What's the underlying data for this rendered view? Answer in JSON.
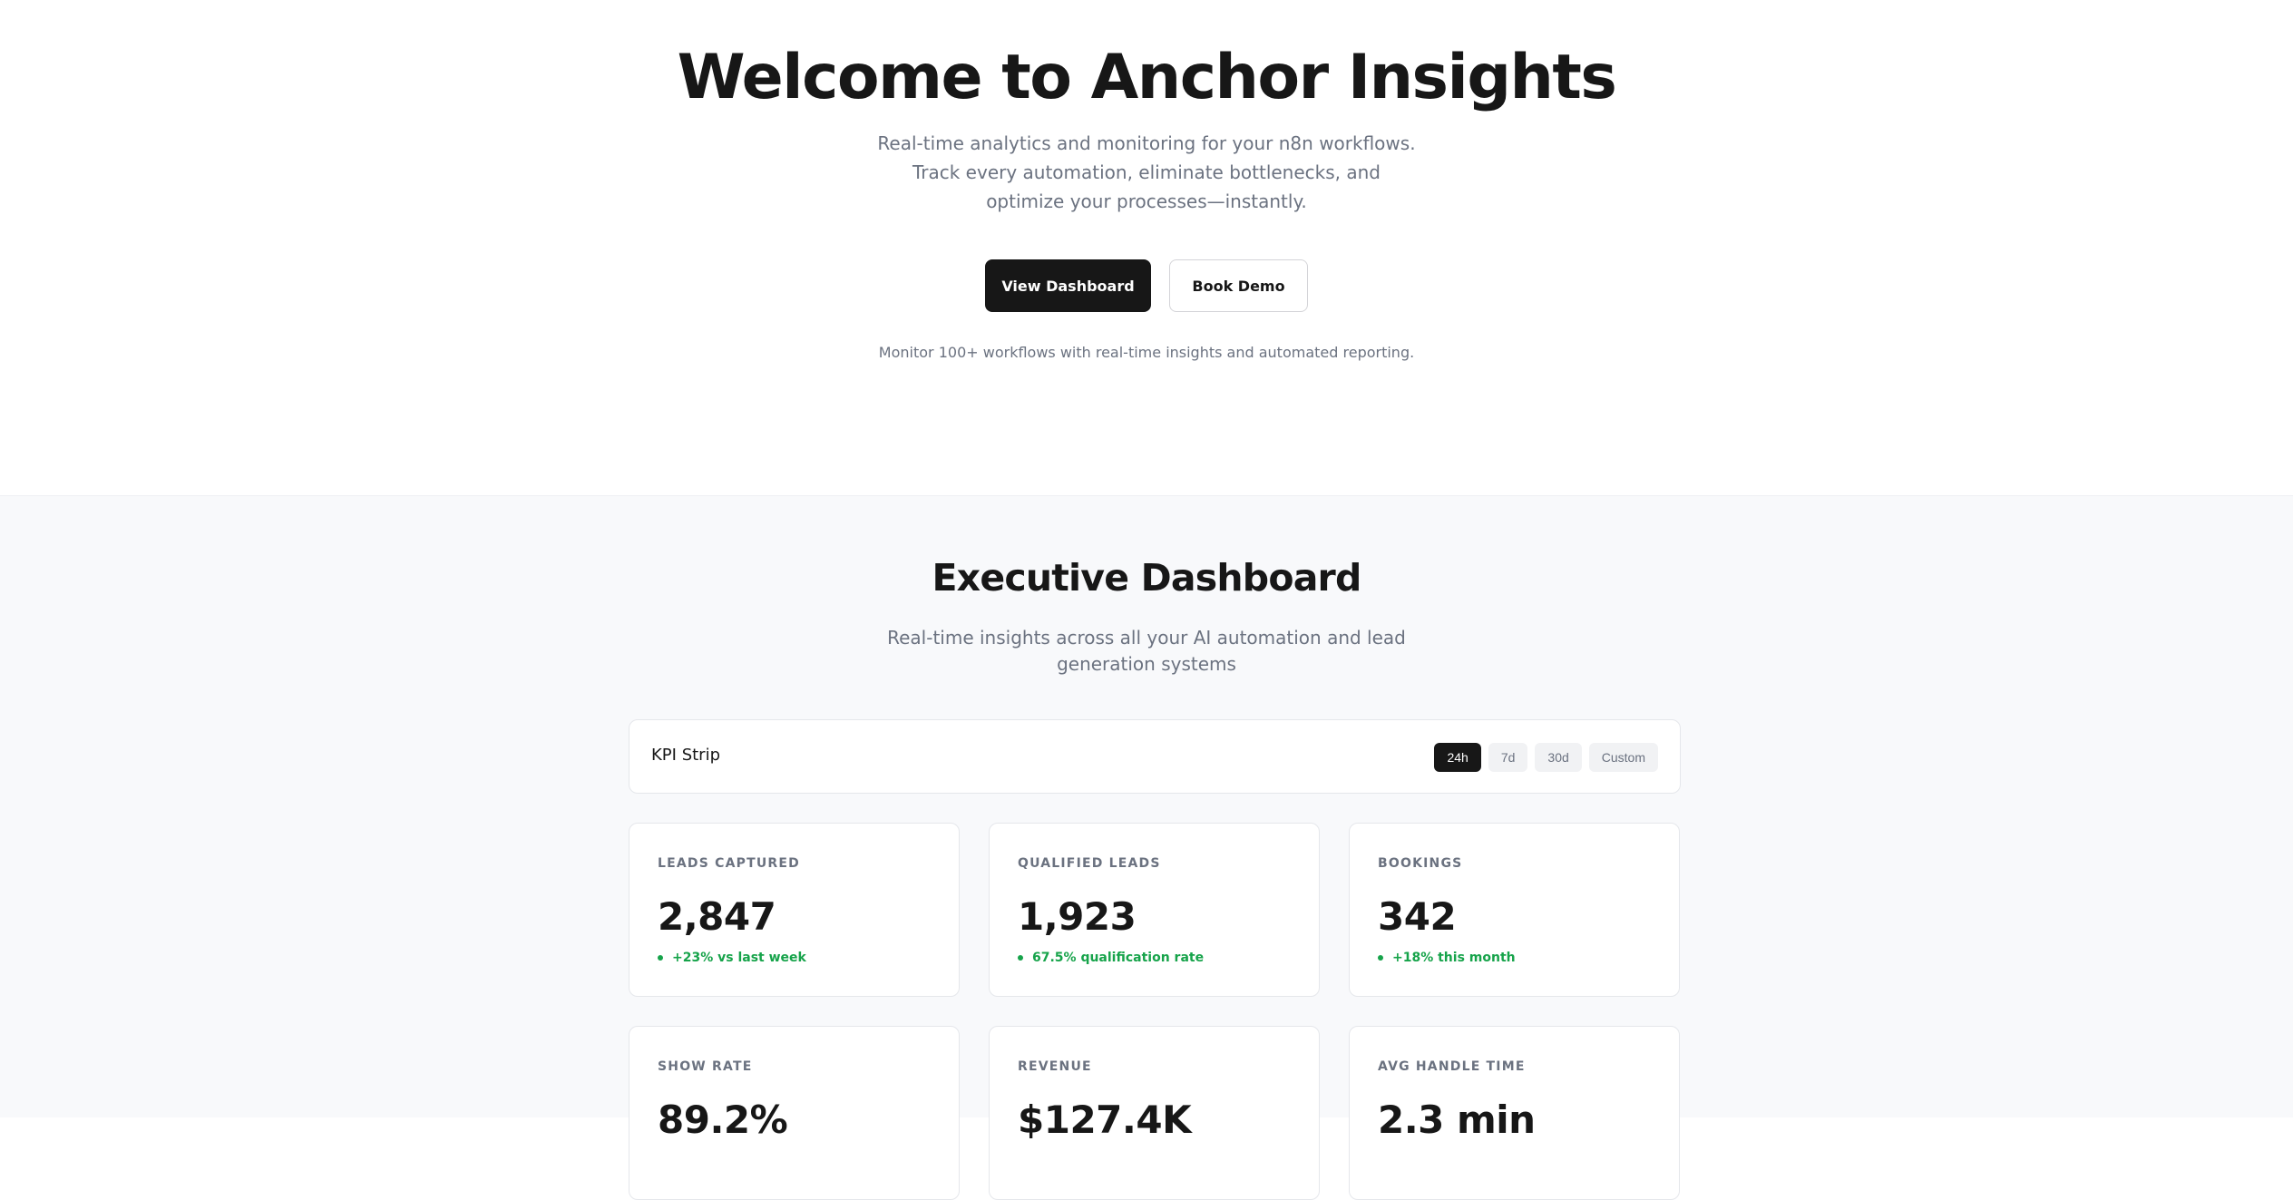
{
  "hero": {
    "title": "Welcome to Anchor Insights",
    "subtitle": "Real-time analytics and monitoring for your n8n workflows. Track every automation, eliminate bottlenecks, and optimize your processes—instantly.",
    "primary_button": "View Dashboard",
    "secondary_button": "Book Demo",
    "note": "Monitor 100+ workflows with real-time insights and automated reporting."
  },
  "dashboard": {
    "title": "Executive Dashboard",
    "subtitle": "Real-time insights across all your AI automation and lead generation systems",
    "kpi_strip": {
      "label": "KPI Strip",
      "ranges": [
        "24h",
        "7d",
        "30d",
        "Custom"
      ],
      "active_range": "24h"
    },
    "cards": [
      {
        "label": "LEADS CAPTURED",
        "value": "2,847",
        "delta": "+23% vs last week"
      },
      {
        "label": "QUALIFIED LEADS",
        "value": "1,923",
        "delta": "67.5% qualification rate"
      },
      {
        "label": "BOOKINGS",
        "value": "342",
        "delta": "+18% this month"
      },
      {
        "label": "SHOW RATE",
        "value": "89.2%",
        "delta": ""
      },
      {
        "label": "REVENUE",
        "value": "$127.4K",
        "delta": ""
      },
      {
        "label": "AVG HANDLE TIME",
        "value": "2.3 min",
        "delta": ""
      }
    ]
  },
  "colors": {
    "primary": "#171717",
    "accent_positive": "#16a34a",
    "muted_text": "#6b7280",
    "section_bg": "#f8f9fb"
  }
}
